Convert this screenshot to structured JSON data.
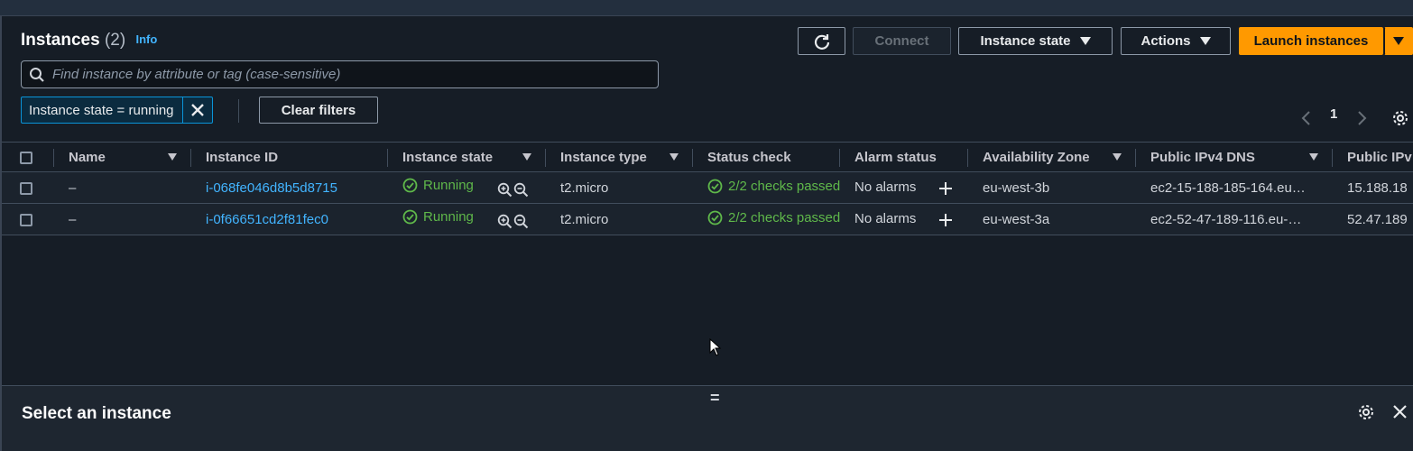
{
  "header": {
    "title": "Instances",
    "count": "(2)",
    "info": "Info"
  },
  "toolbar": {
    "connect_label": "Connect",
    "instance_state_label": "Instance state",
    "actions_label": "Actions",
    "launch_label": "Launch instances"
  },
  "search": {
    "placeholder": "Find instance by attribute or tag (case-sensitive)"
  },
  "filter": {
    "token_label": "Instance state = running",
    "clear_label": "Clear filters"
  },
  "pagination": {
    "current_page": "1"
  },
  "table": {
    "columns": [
      "Name",
      "Instance ID",
      "Instance state",
      "Instance type",
      "Status check",
      "Alarm status",
      "Availability Zone",
      "Public IPv4 DNS",
      "Public IPv"
    ],
    "rows": [
      {
        "name": "–",
        "instance_id": "i-068fe046d8b5d8715",
        "state": "Running",
        "type": "t2.micro",
        "status_check": "2/2 checks passed",
        "alarm": "No alarms",
        "az": "eu-west-3b",
        "dns": "ec2-15-188-185-164.eu…",
        "ip": "15.188.18"
      },
      {
        "name": "–",
        "instance_id": "i-0f66651cd2f81fec0",
        "state": "Running",
        "type": "t2.micro",
        "status_check": "2/2 checks passed",
        "alarm": "No alarms",
        "az": "eu-west-3a",
        "dns": "ec2-52-47-189-116.eu-…",
        "ip": "52.47.189"
      }
    ]
  },
  "details_panel": {
    "title": "Select an instance"
  },
  "colors": {
    "background": "#161d26",
    "accent_orange": "#ff9900",
    "link_blue": "#42b4ff",
    "success_green": "#5fb84a"
  },
  "icons": [
    "refresh-icon",
    "caret-down-icon",
    "search-icon",
    "close-icon",
    "chevron-left-icon",
    "chevron-right-icon",
    "settings-gear-icon",
    "check-circle-icon",
    "zoom-in-icon",
    "zoom-out-icon",
    "plus-icon",
    "drag-handle-icon"
  ]
}
